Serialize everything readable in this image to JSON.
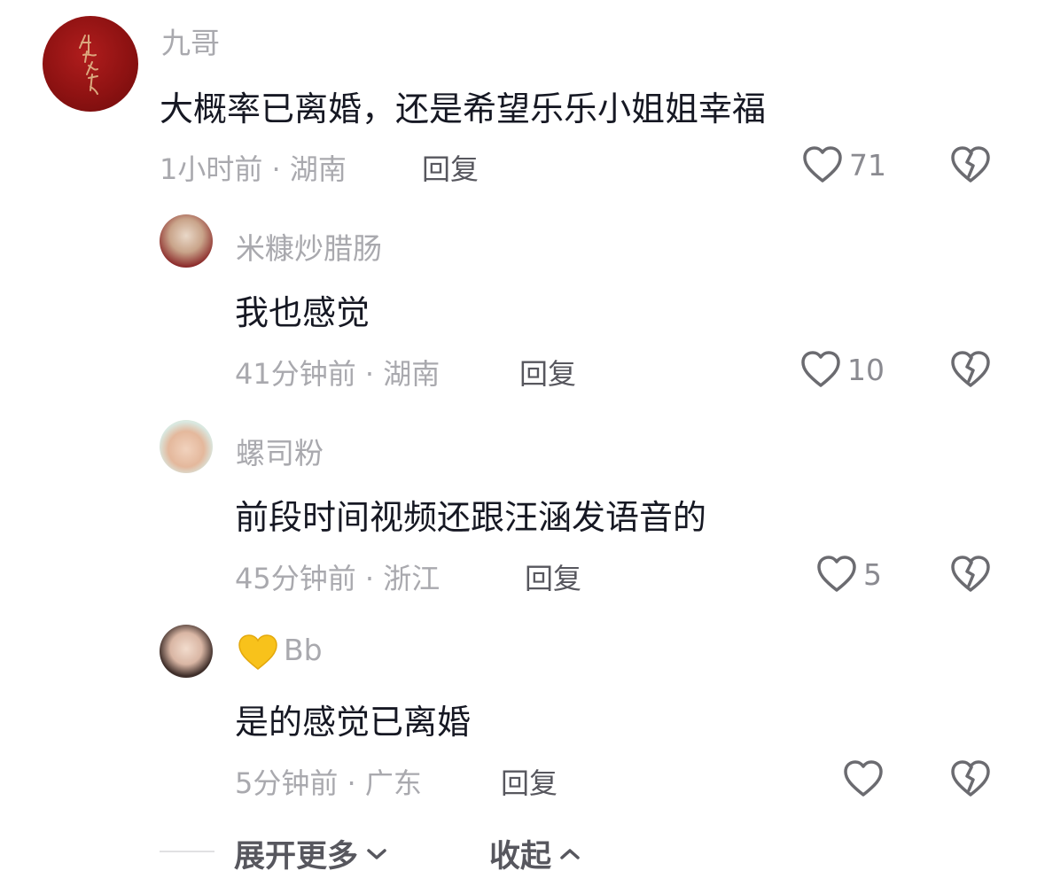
{
  "comments": [
    {
      "username": "九哥",
      "content": "大概率已离婚，还是希望乐乐小姐姐幸福",
      "meta": "1小时前 · 湖南",
      "reply_label": "回复",
      "likes": "71",
      "avatar_text": "仲夏夜之梦"
    },
    {
      "username": "米糠炒腊肠",
      "content": "我也感觉",
      "meta": "41分钟前 · 湖南",
      "reply_label": "回复",
      "likes": "10"
    },
    {
      "username": "螺司粉",
      "content": "前段时间视频还跟汪涵发语音的",
      "meta": "45分钟前 · 浙江",
      "reply_label": "回复",
      "likes": "5"
    },
    {
      "username": "Bb",
      "username_emoji": "yellow-heart",
      "content": "是的感觉已离婚",
      "meta": "5分钟前 · 广东",
      "reply_label": "回复",
      "likes": ""
    }
  ],
  "footer": {
    "expand_label": "展开更多",
    "collapse_label": "收起"
  },
  "colors": {
    "text_primary": "#161823",
    "text_secondary": "#a9a9ae",
    "text_action": "#57575e",
    "icon": "#6b6b70",
    "emoji_heart": "#f8c21b"
  }
}
